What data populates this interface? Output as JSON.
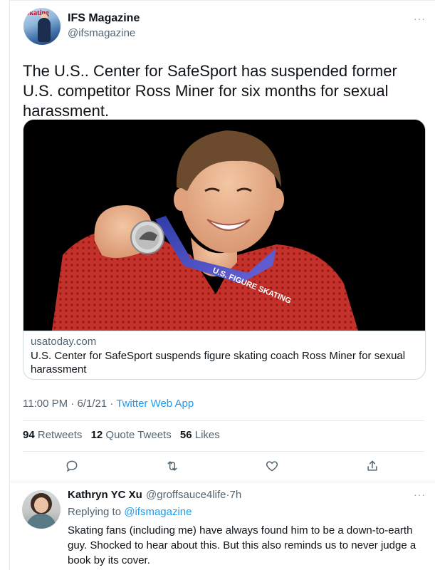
{
  "tweet": {
    "author_name": "IFS Magazine",
    "author_handle": "@ifsmagazine",
    "more_label": "···",
    "avatar_text": "Skating",
    "text": "The U.S.. Center for SafeSport has suspended former U.S. competitor Ross Miner for six months for sexual harassment.",
    "card": {
      "domain": "usatoday.com",
      "title": "U.S. Center for SafeSport suspends figure skating coach Ross Miner for sexual harassment",
      "ribbon_text": "U.S. FIGURE SKATING"
    },
    "time": "11:00 PM",
    "date": "6/1/21",
    "separator": "·",
    "source": "Twitter Web App",
    "stats": {
      "retweets_count": "94",
      "retweets_label": "Retweets",
      "quotes_count": "12",
      "quotes_label": "Quote Tweets",
      "likes_count": "56",
      "likes_label": "Likes"
    },
    "actions": [
      "reply-icon",
      "retweet-icon",
      "like-icon",
      "share-icon"
    ]
  },
  "reply": {
    "name": "Kathryn YC Xu",
    "handle": "@groffsauce4life",
    "separator": "·",
    "time": "7h",
    "more_label": "···",
    "replying_to_label": "Replying to",
    "replying_to_handle": "@ifsmagazine",
    "text": "Skating fans (including me) have always found him to be a down-to-earth guy. Shocked to hear about this. But this also reminds us to never judge a book by its cover."
  },
  "colors": {
    "link": "#1d9bf0",
    "secondary_text": "#536471",
    "border": "#cfd9de",
    "sweater": "#c4312b"
  }
}
